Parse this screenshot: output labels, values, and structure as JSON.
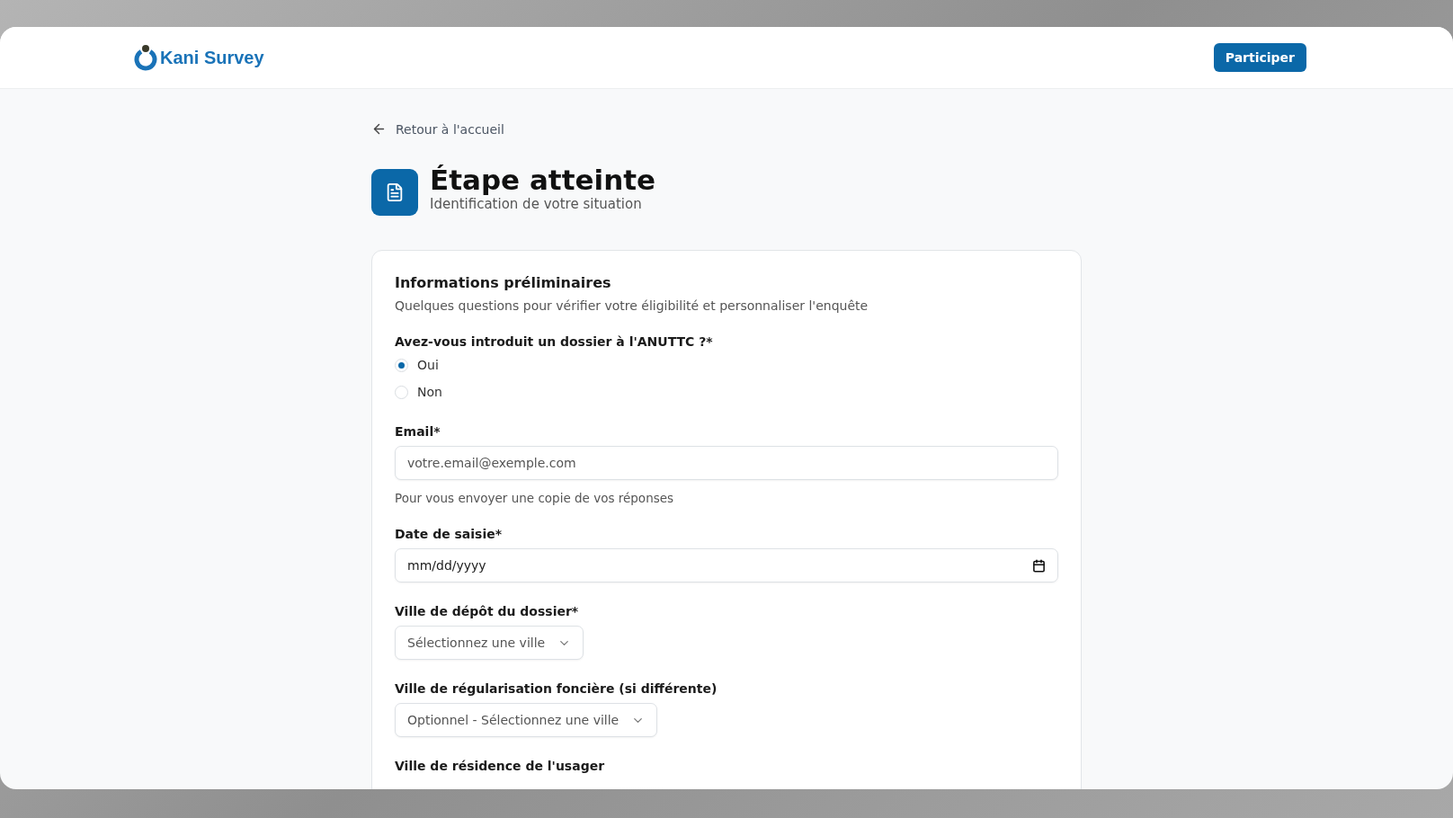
{
  "header": {
    "brand": "Kani Survey",
    "action": "Participer"
  },
  "back_link": "Retour à l'accueil",
  "page": {
    "title": "Étape atteinte",
    "subtitle": "Identification de votre situation"
  },
  "card": {
    "title": "Informations préliminaires",
    "description": "Quelques questions pour vérifier votre éligibilité et personnaliser l'enquête",
    "fields": [
      {
        "kind": "radio",
        "label": "Avez-vous introduit un dossier à l'ANUTTC ?*",
        "options": [
          {
            "label": "Oui",
            "selected": true
          },
          {
            "label": "Non",
            "selected": false
          }
        ]
      },
      {
        "kind": "text",
        "label": "Email*",
        "placeholder": "votre.email@exemple.com",
        "help": "Pour vous envoyer une copie de vos réponses"
      },
      {
        "kind": "date",
        "label": "Date de saisie*",
        "placeholder": "mm/dd/yyyy"
      },
      {
        "kind": "select",
        "label": "Ville de dépôt du dossier*",
        "placeholder": "Sélectionnez une ville"
      },
      {
        "kind": "select",
        "label": "Ville de régularisation foncière (si différente)",
        "placeholder": "Optionnel - Sélectionnez une ville"
      },
      {
        "kind": "label",
        "label": "Ville de résidence de l'usager"
      }
    ]
  }
}
